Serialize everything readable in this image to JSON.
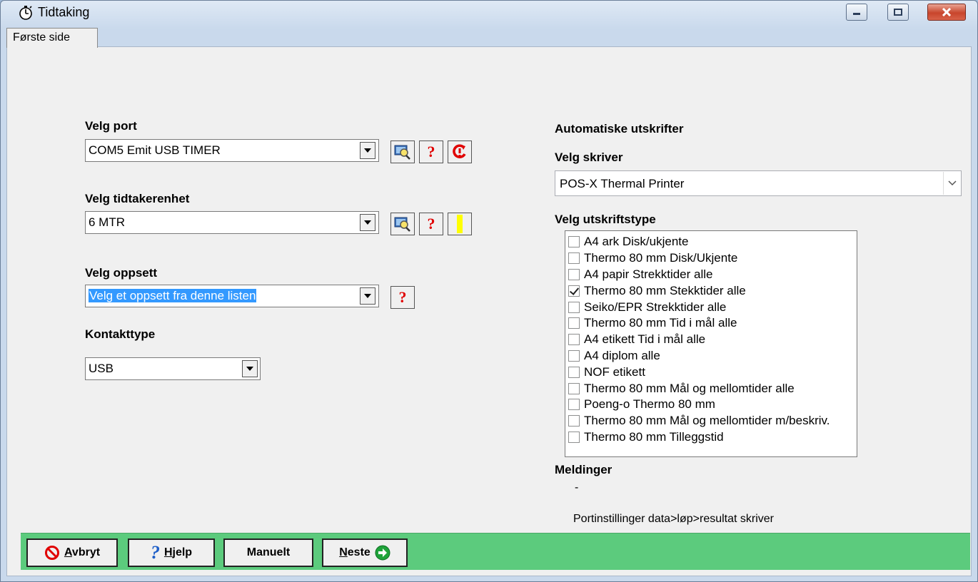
{
  "window": {
    "title": "Tidtaking"
  },
  "tabs": [
    {
      "label": "Første side"
    }
  ],
  "left": {
    "port": {
      "label": "Velg port",
      "value": "COM5 Emit USB TIMER"
    },
    "unit": {
      "label": "Velg tidtakerenhet",
      "value": "6  MTR"
    },
    "setup": {
      "label": "Velg oppsett",
      "value": "Velg et oppsett fra denne listen"
    },
    "contact": {
      "label": "Kontakttype",
      "value": "USB"
    }
  },
  "right": {
    "auto_heading": "Automatiske utskrifter",
    "printer_label": "Velg skriver",
    "printer_value": "POS-X Thermal Printer",
    "printtype_label": "Velg utskriftstype",
    "print_types": [
      {
        "label": "A4 ark Disk/ukjente",
        "checked": false
      },
      {
        "label": "Thermo 80 mm Disk/Ukjente",
        "checked": false
      },
      {
        "label": "A4 papir Strekktider alle",
        "checked": false
      },
      {
        "label": "Thermo 80 mm Stekktider alle",
        "checked": true
      },
      {
        "label": "Seiko/EPR Strekktider alle",
        "checked": false
      },
      {
        "label": "Thermo 80 mm Tid i mål alle",
        "checked": false
      },
      {
        "label": "A4 etikett Tid i mål alle",
        "checked": false
      },
      {
        "label": "A4 diplom alle",
        "checked": false
      },
      {
        "label": "NOF etikett",
        "checked": false
      },
      {
        "label": "Thermo 80 mm Mål og mellomtider alle",
        "checked": false
      },
      {
        "label": "Poeng-o Thermo 80 mm",
        "checked": false
      },
      {
        "label": "Thermo 80 mm Mål og mellomtider m/beskriv.",
        "checked": false
      },
      {
        "label": "Thermo 80 mm Tilleggstid",
        "checked": false
      }
    ],
    "messages_label": "Meldinger",
    "messages_dash": "-",
    "messages_text": "Portinstillinger data>løp>resultat skriver"
  },
  "buttons": {
    "cancel": {
      "key": "A",
      "rest": "vbryt"
    },
    "help": {
      "key": "H",
      "rest": "jelp"
    },
    "manual": "Manuelt",
    "next": {
      "key": "N",
      "rest": "este"
    }
  },
  "colors": {
    "bottom_bar": "#5ccb7d",
    "selection": "#3399ff",
    "close": "#c8452c"
  }
}
